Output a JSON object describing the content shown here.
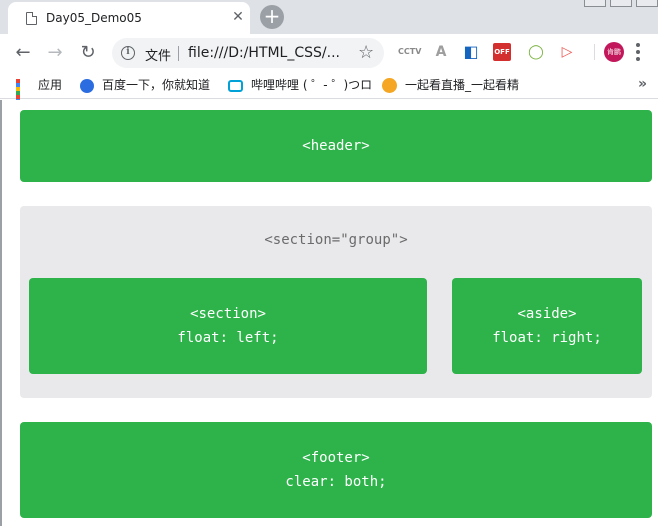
{
  "browser": {
    "tab_title": "Day05_Demo05",
    "tab_close": "✕",
    "new_tab": "+",
    "omnibox_label": "文件",
    "url": "file:///D:/HTML_CSS/...",
    "info_glyph": "i",
    "star_glyph": "☆",
    "back_glyph": "←",
    "forward_glyph": "→",
    "reload_glyph": "↻",
    "avatar_text": "肯鹏",
    "extensions": [
      {
        "name": "cctv-extension-icon",
        "text": "CCTV",
        "color": "#8a8a8a"
      },
      {
        "name": "pdf-extension-icon",
        "text": "A",
        "color": "#9e9e9e"
      },
      {
        "name": "blue-extension-icon",
        "text": "◧",
        "color": "#1565c0"
      },
      {
        "name": "adblock-off-icon",
        "text": "OFF",
        "color": "#d32f2f"
      },
      {
        "name": "leaf-extension-icon",
        "text": "◯",
        "color": "#7cb342"
      },
      {
        "name": "play-extension-icon",
        "text": "▷",
        "color": "#ef5350"
      }
    ]
  },
  "bookmarks": {
    "items": [
      {
        "label": "应用",
        "icon": "apps-grid-icon"
      },
      {
        "label": "百度一下，你就知道",
        "icon": "baidu-paw-icon"
      },
      {
        "label": "哔哩哔哩 ( ゜- ゜)つロ",
        "icon": "bilibili-tv-icon"
      },
      {
        "label": "一起看直播_一起看精",
        "icon": "yiqikan-face-icon"
      }
    ],
    "more": "»"
  },
  "page": {
    "header": "<header>",
    "group": "<section=\"group\">",
    "section_tag": "<section>",
    "section_css": "float: left;",
    "aside_tag": "<aside>",
    "aside_css": "float: right;",
    "footer_tag": "<footer>",
    "footer_css": "clear: both;"
  },
  "colors": {
    "box_green": "#2db34a",
    "group_gray": "#e9e9ec",
    "tabstrip": "#dee1e6"
  }
}
